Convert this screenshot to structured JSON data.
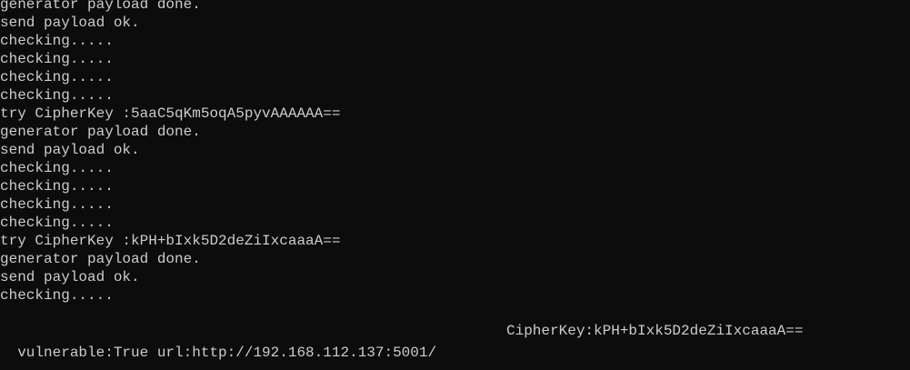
{
  "terminal": {
    "lines": [
      "generator payload done.",
      "send payload ok.",
      "checking.....",
      "checking.....",
      "checking.....",
      "checking.....",
      "try CipherKey :5aaC5qKm5oqA5pyvAAAAAA==",
      "generator payload done.",
      "send payload ok.",
      "checking.....",
      "checking.....",
      "checking.....",
      "checking.....",
      "try CipherKey :kPH+bIxk5D2deZiIxcaaaA==",
      "generator payload done.",
      "send payload ok.",
      "checking....."
    ],
    "result": {
      "vulnerable": "vulnerable:True url:http://192.168.112.137:5001/",
      "cipherkey": "CipherKey:kPH+bIxk5D2deZiIxcaaaA=="
    }
  }
}
